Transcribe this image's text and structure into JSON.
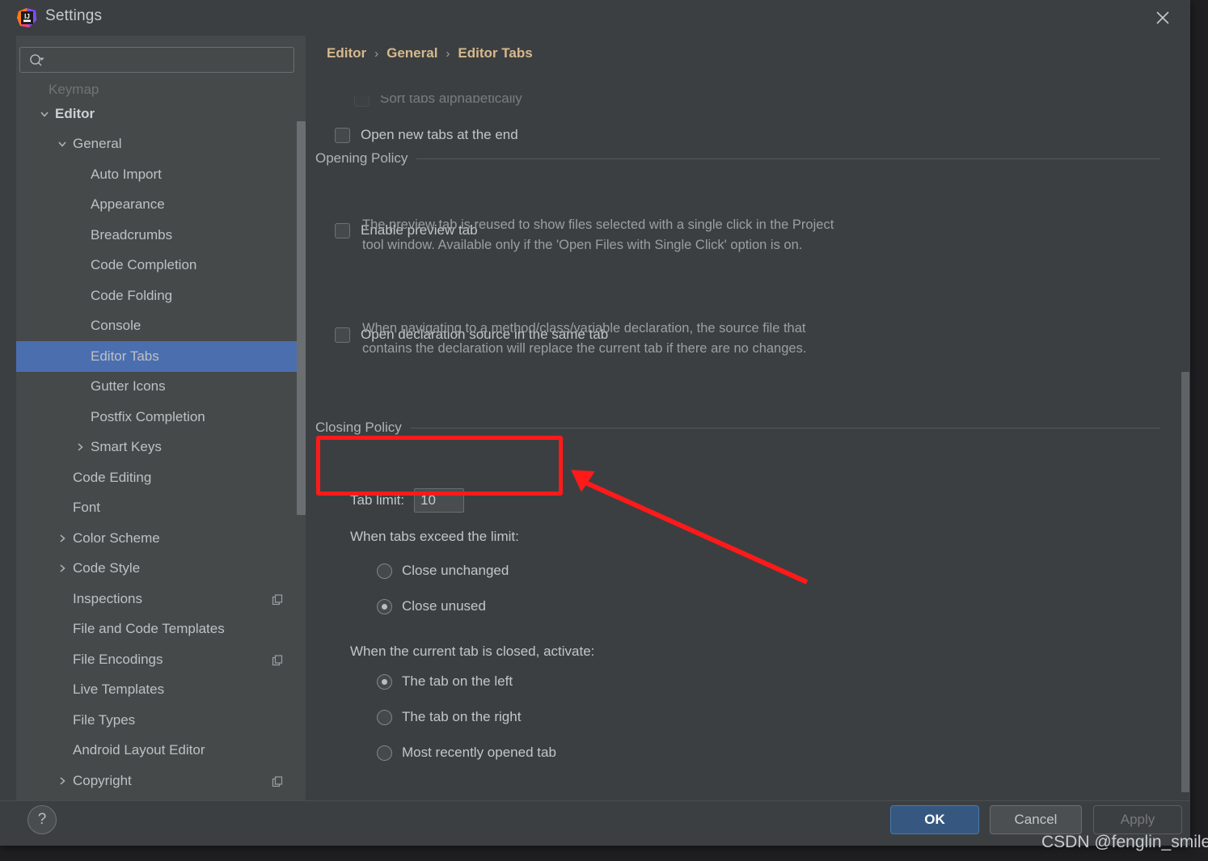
{
  "window": {
    "title": "Settings",
    "app_icon": "intellij-idea-logo",
    "close_icon": "close-icon"
  },
  "sidebar": {
    "search": {
      "placeholder": "",
      "value": "",
      "icon": "search-icon"
    },
    "clipped_top_item": "Keymap",
    "items": [
      {
        "label": "Editor",
        "indent": 0,
        "twisty": "chevron-down",
        "bold": true,
        "selected": false,
        "badge": false
      },
      {
        "label": "General",
        "indent": 1,
        "twisty": "chevron-down",
        "bold": false,
        "selected": false,
        "badge": false
      },
      {
        "label": "Auto Import",
        "indent": 2,
        "twisty": "none",
        "bold": false,
        "selected": false,
        "badge": false
      },
      {
        "label": "Appearance",
        "indent": 2,
        "twisty": "none",
        "bold": false,
        "selected": false,
        "badge": false
      },
      {
        "label": "Breadcrumbs",
        "indent": 2,
        "twisty": "none",
        "bold": false,
        "selected": false,
        "badge": false
      },
      {
        "label": "Code Completion",
        "indent": 2,
        "twisty": "none",
        "bold": false,
        "selected": false,
        "badge": false
      },
      {
        "label": "Code Folding",
        "indent": 2,
        "twisty": "none",
        "bold": false,
        "selected": false,
        "badge": false
      },
      {
        "label": "Console",
        "indent": 2,
        "twisty": "none",
        "bold": false,
        "selected": false,
        "badge": false
      },
      {
        "label": "Editor Tabs",
        "indent": 2,
        "twisty": "none",
        "bold": false,
        "selected": true,
        "badge": false
      },
      {
        "label": "Gutter Icons",
        "indent": 2,
        "twisty": "none",
        "bold": false,
        "selected": false,
        "badge": false
      },
      {
        "label": "Postfix Completion",
        "indent": 2,
        "twisty": "none",
        "bold": false,
        "selected": false,
        "badge": false
      },
      {
        "label": "Smart Keys",
        "indent": 2,
        "twisty": "chevron-right",
        "bold": false,
        "selected": false,
        "badge": false
      },
      {
        "label": "Code Editing",
        "indent": 1,
        "twisty": "none",
        "bold": false,
        "selected": false,
        "badge": false
      },
      {
        "label": "Font",
        "indent": 1,
        "twisty": "none",
        "bold": false,
        "selected": false,
        "badge": false
      },
      {
        "label": "Color Scheme",
        "indent": 1,
        "twisty": "chevron-right",
        "bold": false,
        "selected": false,
        "badge": false
      },
      {
        "label": "Code Style",
        "indent": 1,
        "twisty": "chevron-right",
        "bold": false,
        "selected": false,
        "badge": false
      },
      {
        "label": "Inspections",
        "indent": 1,
        "twisty": "none",
        "bold": false,
        "selected": false,
        "badge": true
      },
      {
        "label": "File and Code Templates",
        "indent": 1,
        "twisty": "none",
        "bold": false,
        "selected": false,
        "badge": false
      },
      {
        "label": "File Encodings",
        "indent": 1,
        "twisty": "none",
        "bold": false,
        "selected": false,
        "badge": true
      },
      {
        "label": "Live Templates",
        "indent": 1,
        "twisty": "none",
        "bold": false,
        "selected": false,
        "badge": false
      },
      {
        "label": "File Types",
        "indent": 1,
        "twisty": "none",
        "bold": false,
        "selected": false,
        "badge": false
      },
      {
        "label": "Android Layout Editor",
        "indent": 1,
        "twisty": "none",
        "bold": false,
        "selected": false,
        "badge": false
      },
      {
        "label": "Copyright",
        "indent": 1,
        "twisty": "chevron-right",
        "bold": false,
        "selected": false,
        "badge": true
      }
    ]
  },
  "breadcrumb": {
    "part1": "Editor",
    "sep1": "›",
    "part2": "General",
    "sep2": "›",
    "part3": "Editor Tabs"
  },
  "content": {
    "clipped_checkbox": "Sort tabs alphabetically",
    "open_new_tabs_label": "Open new tabs at the end",
    "opening_policy_title": "Opening Policy",
    "enable_preview_label": "Enable preview tab",
    "enable_preview_desc": "The preview tab is reused to show files selected with a single click in the Project tool window. Available only if the 'Open Files with Single Click' option is on.",
    "open_declaration_label": "Open declaration source in the same tab",
    "open_declaration_desc": "When navigating to a method/class/variable declaration, the source file that contains the declaration will replace the current tab if there are no changes.",
    "closing_policy_title": "Closing Policy",
    "tab_limit_label": "Tab limit:",
    "tab_limit_value": "10",
    "exceed_limit_label": "When tabs exceed the limit:",
    "exceed_options": [
      {
        "label": "Close unchanged",
        "selected": false
      },
      {
        "label": "Close unused",
        "selected": true
      }
    ],
    "closed_activate_label": "When the current tab is closed, activate:",
    "activate_options": [
      {
        "label": "The tab on the left",
        "selected": true
      },
      {
        "label": "The tab on the right",
        "selected": false
      },
      {
        "label": "Most recently opened tab",
        "selected": false
      }
    ]
  },
  "footer": {
    "help_label": "?",
    "ok_label": "OK",
    "cancel_label": "Cancel",
    "apply_label": "Apply"
  },
  "annotations": {
    "watermark": "CSDN @fenglin_smile",
    "highlight_color": "#ff1a1a",
    "arrow_color": "#ff1a1a"
  },
  "colors": {
    "window_bg": "#3c3f41",
    "sidebar_bg": "#45494a",
    "selection": "#4b6eaf",
    "breadcrumb_text": "#d6b98c",
    "ok_button": "#365880"
  }
}
